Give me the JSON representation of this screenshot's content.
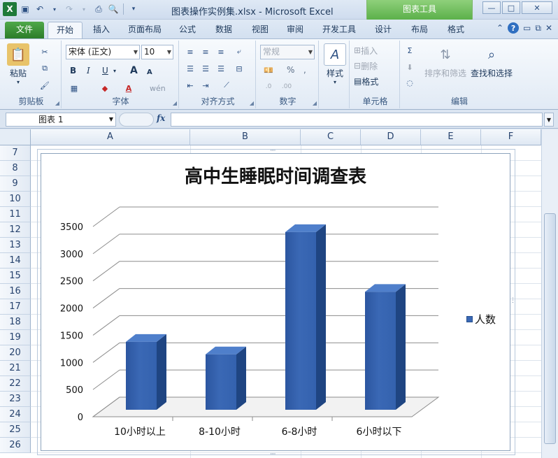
{
  "window": {
    "title": "图表操作实例集.xlsx - Microsoft Excel",
    "context_tools": "图表工具",
    "controls": [
      "—",
      "□",
      "✕"
    ]
  },
  "ribbon": {
    "tabs": [
      "文件",
      "开始",
      "插入",
      "页面布局",
      "公式",
      "数据",
      "视图",
      "审阅",
      "开发工具",
      "设计",
      "布局",
      "格式"
    ],
    "active_tab": "开始",
    "groups": {
      "clipboard": {
        "label": "剪贴板",
        "paste": "粘贴"
      },
      "font": {
        "label": "字体",
        "font_name": "宋体 (正文)",
        "font_size": "10",
        "bold": "B",
        "italic": "I",
        "underline": "U",
        "grow": "A",
        "shrink": "A",
        "wen": "wén"
      },
      "alignment": {
        "label": "对齐方式"
      },
      "number": {
        "label": "数字",
        "format": "常规",
        "percent": "%",
        "comma": ","
      },
      "styles": {
        "label": "样式"
      },
      "cells": {
        "label": "单元格",
        "insert": "插入",
        "delete": "删除",
        "format": "格式"
      },
      "editing": {
        "label": "编辑",
        "sort_filter": "排序和筛选",
        "find_select": "查找和选择"
      }
    }
  },
  "formula_bar": {
    "name_box": "图表 1",
    "fx": "fx",
    "value": ""
  },
  "grid": {
    "columns": [
      "A",
      "B",
      "C",
      "D",
      "E",
      "F"
    ],
    "rows": [
      "7",
      "8",
      "9",
      "10",
      "11",
      "12",
      "13",
      "14",
      "15",
      "16",
      "17",
      "18",
      "19",
      "20",
      "21",
      "22",
      "23",
      "24",
      "25",
      "26"
    ]
  },
  "chart_data": {
    "type": "bar",
    "title": "高中生睡眠时间调查表",
    "categories": [
      "10小时以上",
      "8-10小时",
      "6-8小时",
      "6小时以下"
    ],
    "series": [
      {
        "name": "人数",
        "values": [
          1250,
          1020,
          3270,
          2170
        ]
      }
    ],
    "ylim": [
      0,
      3500
    ],
    "yticks": [
      "0",
      "500",
      "1000",
      "1500",
      "2000",
      "2500",
      "3000",
      "3500"
    ],
    "xlabel": "",
    "ylabel": "",
    "legend": "right",
    "grid": true,
    "bar_color": "#3a68b5",
    "style": "3d-column"
  }
}
